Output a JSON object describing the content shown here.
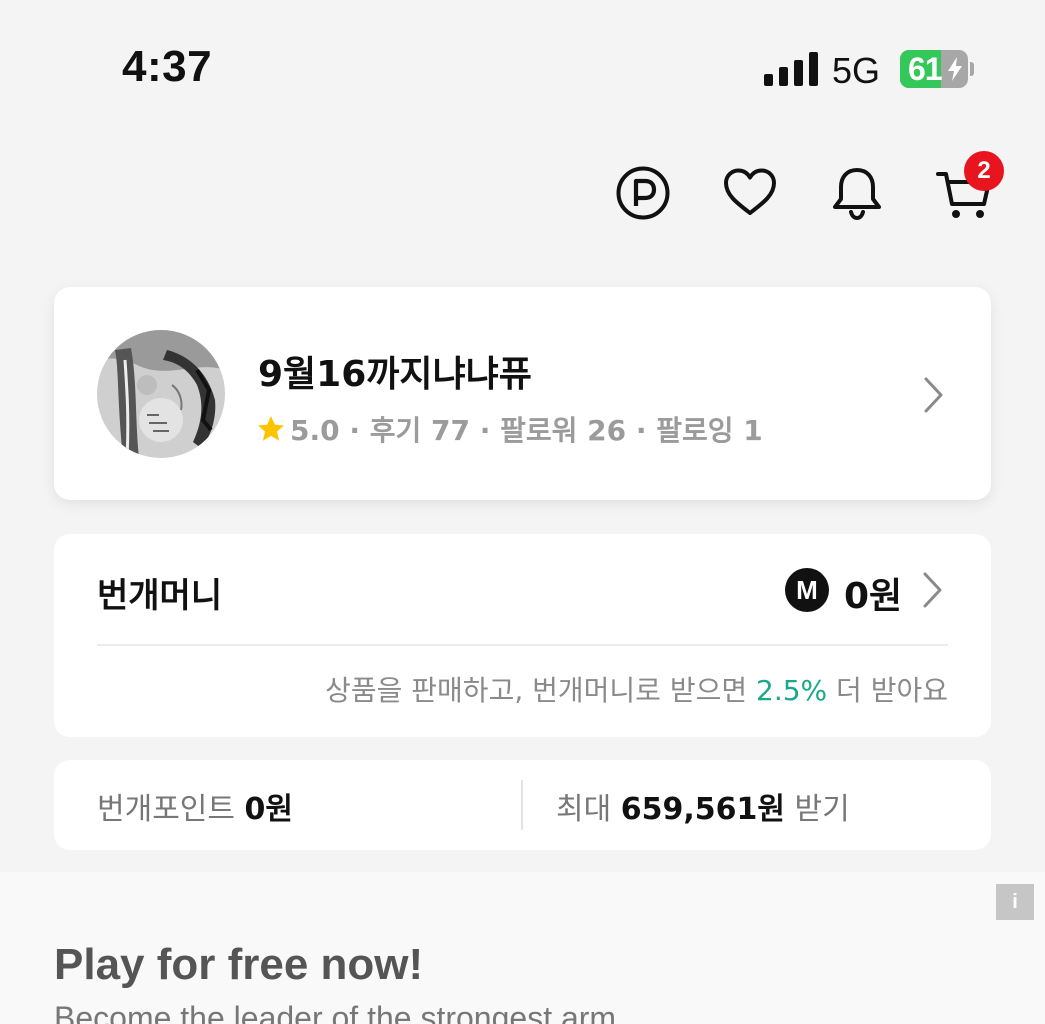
{
  "status_bar": {
    "time": "4:37",
    "network": "5G",
    "battery_percent": "61",
    "battery_level": 0.61
  },
  "header_icons": {
    "cart_badge_count": "2"
  },
  "profile": {
    "name": "9월16까지냐냐퓨",
    "rating": "5.0",
    "stats": "5.0 · 후기 77 · 팔로워 26 · 팔로잉 1"
  },
  "bungae_money": {
    "title": "번개머니",
    "icon_letter": "M",
    "amount": "0원",
    "note_prefix": "상품을 판매하고, 번개머니로 받으면 ",
    "note_rate": "2.5%",
    "note_suffix": " 더 받아요"
  },
  "bungae_points": {
    "label": "번개포인트 ",
    "amount": "0원",
    "max_prefix": "최대 ",
    "max_amount": "659,561원",
    "max_suffix": " 받기"
  },
  "ad": {
    "info_label": "i",
    "title": "Play for free now!",
    "subtitle": "Become the leader of the strongest arm"
  },
  "colors": {
    "accent_green": "#1aa88a",
    "badge_red": "#e8141e",
    "star_yellow": "#ffc400",
    "battery_green": "#34c759"
  },
  "icons": [
    "point-icon",
    "heart-icon",
    "bell-icon",
    "cart-icon",
    "star-icon",
    "chevron-right-icon",
    "bungae-money-icon",
    "ad-info-icon"
  ]
}
